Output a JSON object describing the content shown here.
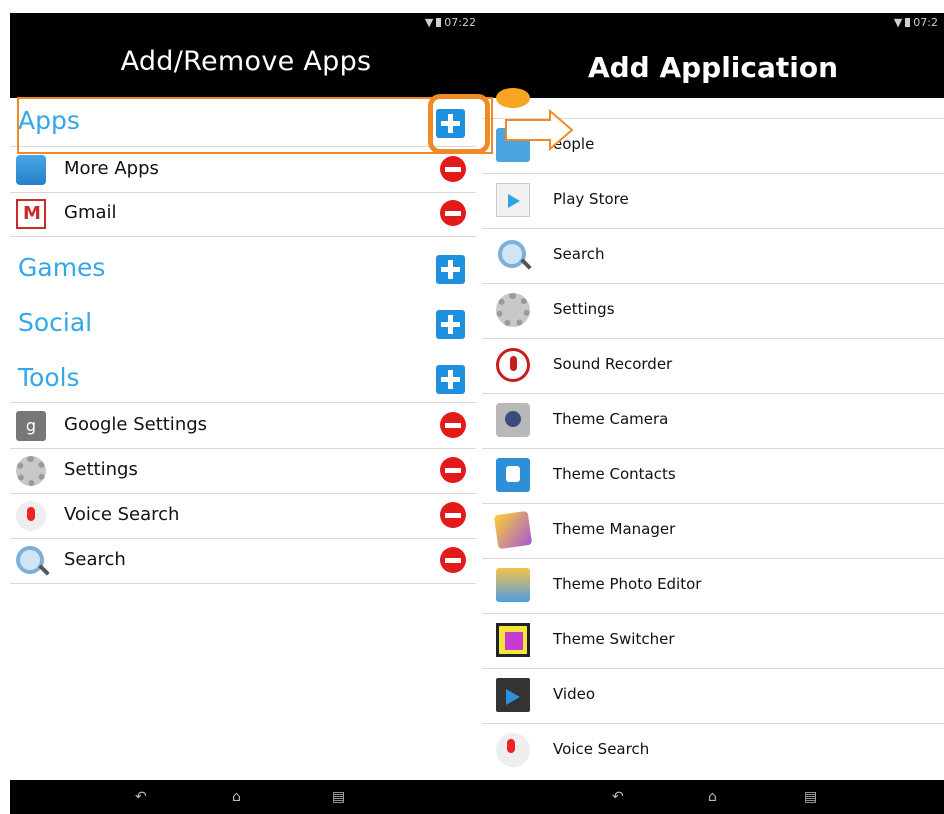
{
  "left": {
    "status_time": "07:22",
    "title": "Add/Remove Apps",
    "categories": [
      {
        "label": "Apps"
      },
      {
        "label": "Games"
      },
      {
        "label": "Social"
      },
      {
        "label": "Tools"
      }
    ],
    "apps_items": [
      {
        "label": "More Apps",
        "icon": "play-store-bag-icon"
      },
      {
        "label": "Gmail",
        "icon": "gmail-icon"
      }
    ],
    "tools_items": [
      {
        "label": "Google Settings",
        "icon": "google-settings-icon"
      },
      {
        "label": "Settings",
        "icon": "gear-icon"
      },
      {
        "label": "Voice Search",
        "icon": "microphone-icon"
      },
      {
        "label": "Search",
        "icon": "magnifier-icon"
      }
    ],
    "nav": {
      "back": "back-icon",
      "home": "home-icon",
      "recents": "recents-icon"
    }
  },
  "right": {
    "status_time": "07:2",
    "title": "Add Application",
    "apps": [
      {
        "label": "eople",
        "icon": "people-icon"
      },
      {
        "label": "Play Store",
        "icon": "play-store-icon"
      },
      {
        "label": "Search",
        "icon": "magnifier-icon"
      },
      {
        "label": "Settings",
        "icon": "gear-icon"
      },
      {
        "label": "Sound Recorder",
        "icon": "sound-recorder-icon"
      },
      {
        "label": "Theme Camera",
        "icon": "camera-icon"
      },
      {
        "label": "Theme Contacts",
        "icon": "contacts-icon"
      },
      {
        "label": "Theme Manager",
        "icon": "theme-manager-icon"
      },
      {
        "label": "Theme Photo Editor",
        "icon": "photo-editor-icon"
      },
      {
        "label": "Theme Switcher",
        "icon": "theme-switcher-icon"
      },
      {
        "label": "Video",
        "icon": "video-icon"
      },
      {
        "label": "Voice Search",
        "icon": "microphone-icon"
      }
    ]
  },
  "colors": {
    "category_blue": "#33a8e8",
    "add_button_blue": "#1f8fe0",
    "remove_red": "#e21a1a",
    "highlight_orange": "#f08a24"
  }
}
